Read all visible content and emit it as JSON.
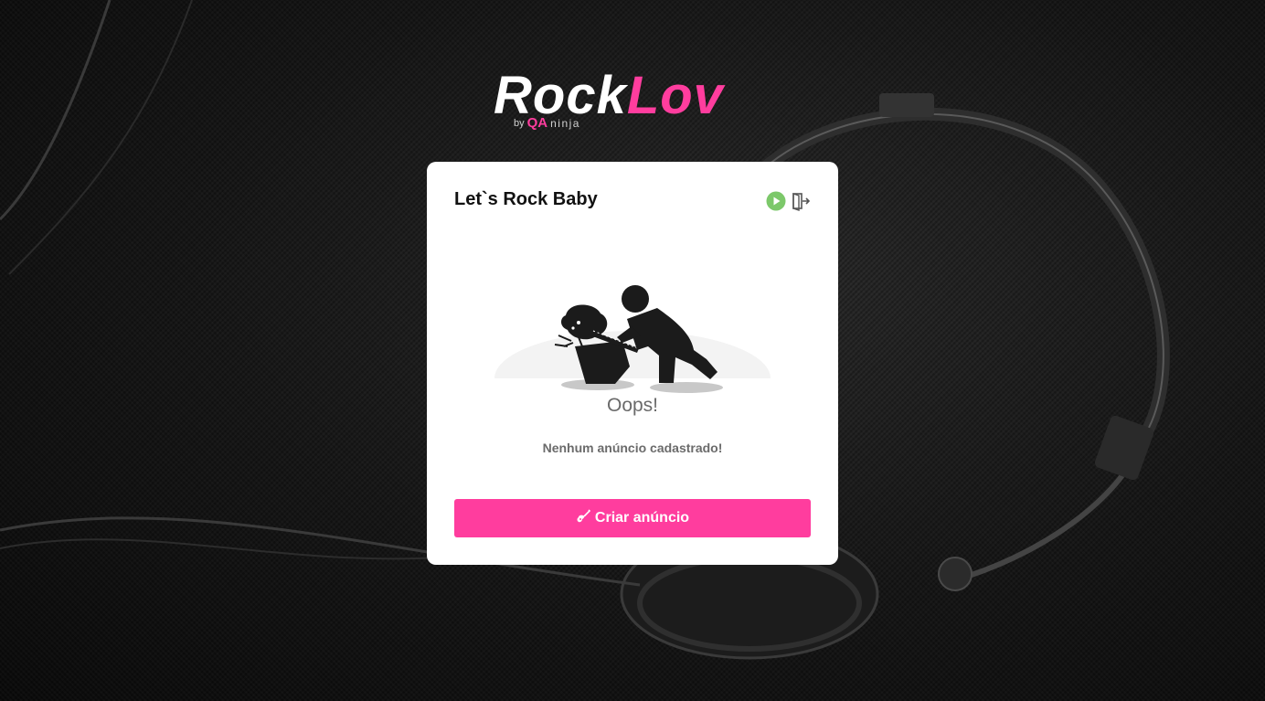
{
  "brand": {
    "part1": "Rock",
    "part2": "Lov",
    "by": "by",
    "qa": "QA",
    "ninja": "ninja"
  },
  "card": {
    "title": "Let`s Rock Baby",
    "empty_title": "Oops!",
    "empty_message": "Nenhum anúncio cadastrado!",
    "create_button_label": "Criar anúncio",
    "create_button_icon": "guitar-icon",
    "play_icon": "play-circle-icon",
    "logout_icon": "logout-door-icon"
  },
  "colors": {
    "accent": "#ff3d9e",
    "play_green": "#7cc86a",
    "background": "#161616"
  }
}
